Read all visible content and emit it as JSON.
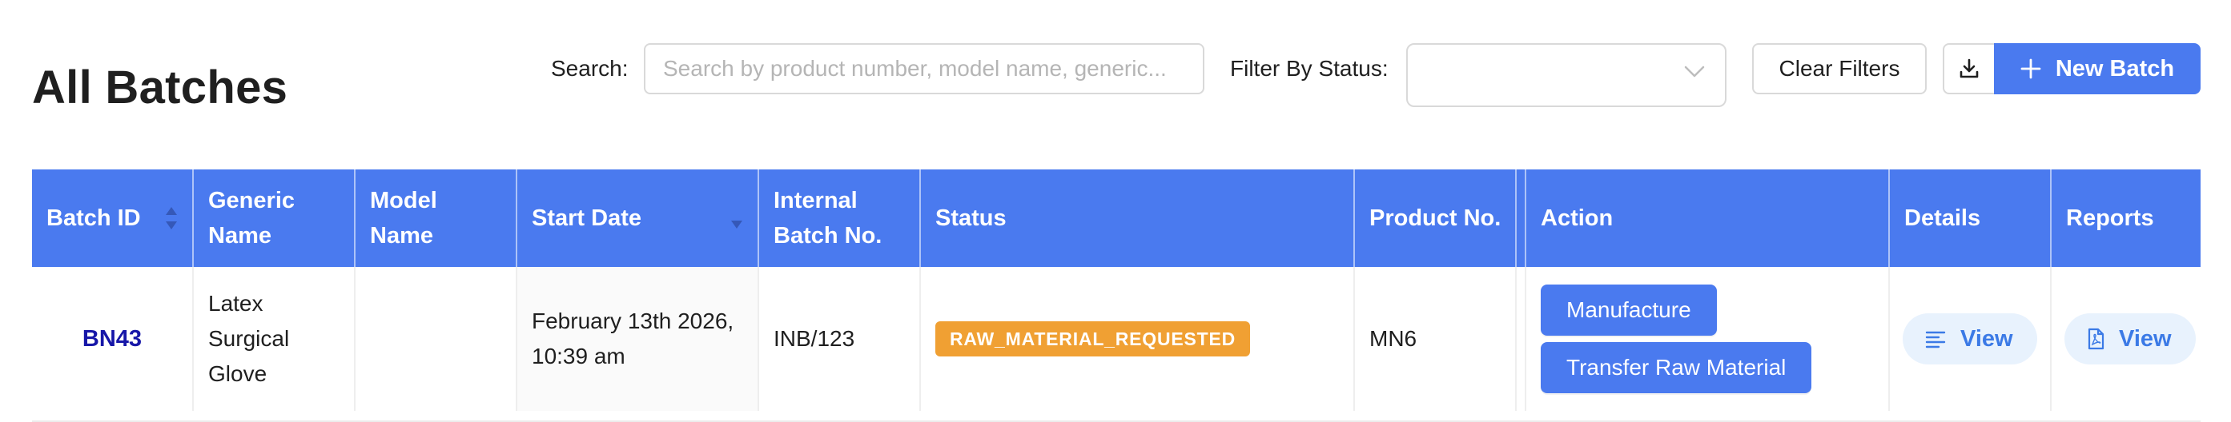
{
  "header": {
    "title": "All Batches",
    "search_label": "Search:",
    "search_placeholder": "Search by product number, model name, generic...",
    "search_value": "",
    "status_label": "Filter By Status:",
    "status_value": "",
    "clear_label": "Clear Filters",
    "new_label": "New Batch"
  },
  "table": {
    "columns": [
      "Batch ID",
      "Generic Name",
      "Model Name",
      "Start Date",
      "Internal Batch No.",
      "Status",
      "Product No.",
      "",
      "Action",
      "Details",
      "Reports"
    ],
    "rows": [
      {
        "batch_id": "BN43",
        "generic_name": "Latex Surgical Glove",
        "model_name": "",
        "start_date": "February 13th 2026, 10:39 am",
        "internal_batch_no": "INB/123",
        "status": "RAW_MATERIAL_REQUESTED",
        "product_no": "MN6",
        "actions": [
          "Manufacture",
          "Transfer Raw Material"
        ],
        "details_label": "View",
        "reports_label": "View"
      }
    ]
  },
  "colors": {
    "primary": "#4a7aef",
    "status_warning": "#f0a033",
    "link": "#1717a8",
    "view_bg": "#e8f2fd",
    "view_text": "#3b7ae6"
  },
  "icons": [
    "chevron-down-icon",
    "download-icon",
    "plus-icon",
    "sort-icon",
    "details-list-icon",
    "pdf-file-icon"
  ]
}
